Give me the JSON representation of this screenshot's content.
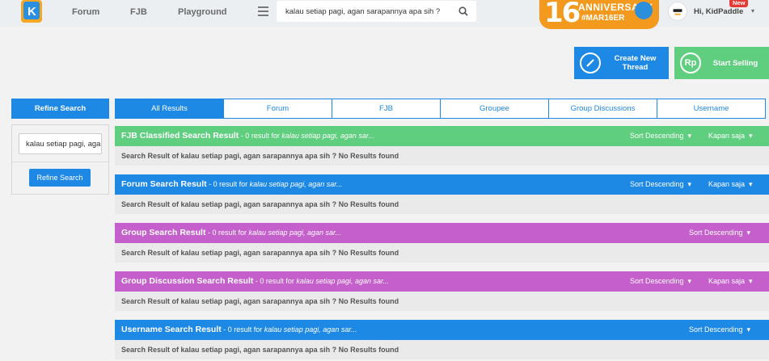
{
  "nav": {
    "links": [
      "Forum",
      "FJB",
      "Playground"
    ],
    "search_value": "kalau setiap pagi, agan sarapannya apa sih ?",
    "anniversary": {
      "number": "16",
      "title": "ANNIVERSARY",
      "tag": "#MAR16ER"
    },
    "greeting": "Hi, KidPaddle",
    "new_badge": "New"
  },
  "actions": {
    "create_label": "Create New Thread",
    "sell_label": "Start Selling",
    "sell_icon": "Rp"
  },
  "refine": {
    "title": "Refine Search",
    "input_value": "kalau setiap pagi, agan sarapannya apa sih ?",
    "button": "Refine Search"
  },
  "tabs": [
    "All Results",
    "Forum",
    "FJB",
    "Groupee",
    "Group Discussions",
    "Username"
  ],
  "query_short": "kalau setiap pagi, agan sar...",
  "sections": [
    {
      "title": "FJB Classified Search Result",
      "count": " - 0 result for ",
      "sort": "Sort Descending",
      "time": "Kapan saja",
      "body": "Search Result of kalau setiap pagi, agan sarapannya apa sih ? No Results found",
      "color": "#5fce7e"
    },
    {
      "title": "Forum Search Result",
      "count": " - 0 result for ",
      "sort": "Sort Descending",
      "time": "Kapan saja",
      "body": "Search Result of kalau setiap pagi, agan sarapannya apa sih ? No Results found",
      "color": "#1e88e5"
    },
    {
      "title": "Group Search Result",
      "count": " - 0 result for ",
      "sort": "Sort Descending",
      "time": "",
      "body": "Search Result of kalau setiap pagi, agan sarapannya apa sih ? No Results found",
      "color": "#c45fcb"
    },
    {
      "title": "Group Discussion Search Result",
      "count": " - 0 result for ",
      "sort": "Sort Descending",
      "time": "Kapan saja",
      "body": "Search Result of kalau setiap pagi, agan sarapannya apa sih ? No Results found",
      "color": "#c45fcb"
    },
    {
      "title": "Username Search Result",
      "count": " - 0 result for ",
      "sort": "Sort Descending",
      "time": "",
      "body": "Search Result of kalau setiap pagi, agan sarapannya apa sih ? No Results found",
      "color": "#1e88e5"
    }
  ]
}
